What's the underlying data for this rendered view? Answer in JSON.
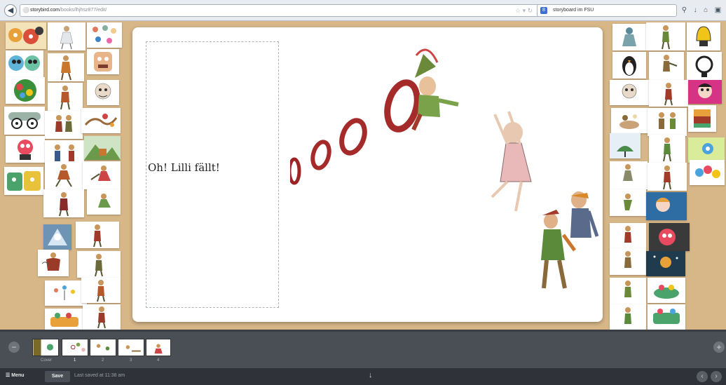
{
  "browser": {
    "url_host": "storybird.com",
    "url_path": "/books/lhjhsz877/edit/",
    "search_text": "storyboard im FSU",
    "search_engine_letter": "8"
  },
  "canvas": {
    "story_text": "Oh! Lilli fällt!"
  },
  "filmstrip": {
    "pages": [
      {
        "label": "Cover"
      },
      {
        "label": "1"
      },
      {
        "label": "2"
      },
      {
        "label": "3"
      },
      {
        "label": "4"
      }
    ],
    "current_page": "1"
  },
  "bottom_bar": {
    "menu_label": "Menu",
    "save_label": "Save",
    "save_status": "Last saved at 11:38 am"
  },
  "art_library": {
    "left_count": 31,
    "right_count": 30
  },
  "icons": {
    "back": "back-arrow-icon",
    "globe": "globe-icon",
    "star": "bookmark-star-icon",
    "reload": "reload-icon",
    "search": "search-icon",
    "download": "download-icon",
    "home": "home-icon",
    "menu": "hamburger-icon",
    "collapse": "double-chevron-down-icon"
  },
  "colors": {
    "page_background": "#d7b788",
    "filmstrip": "#4a4e55",
    "bottom_bar": "#2f3238"
  }
}
